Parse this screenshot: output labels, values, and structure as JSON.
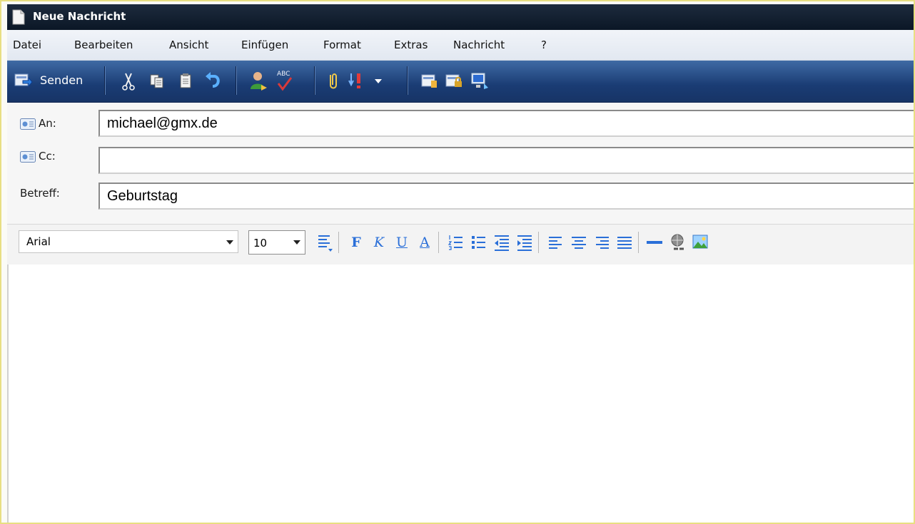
{
  "window": {
    "title": "Neue Nachricht"
  },
  "menu": [
    "Datei",
    "Bearbeiten",
    "Ansicht",
    "Einfügen",
    "Format",
    "Extras",
    "Nachricht",
    "?"
  ],
  "toolbar": {
    "send_label": "Senden",
    "spell_icon_text": "ABC",
    "icons": [
      "send-icon",
      "cut-icon",
      "copy-icon",
      "paste-icon",
      "undo-icon",
      "contacts-icon",
      "spellcheck-icon",
      "attach-icon",
      "priority-icon",
      "dropdown-icon",
      "sign-icon",
      "encrypt-icon",
      "work-offline-icon"
    ]
  },
  "headers": {
    "to": {
      "label": "An:",
      "value": "michael@gmx.de"
    },
    "cc": {
      "label": "Cc:",
      "value": ""
    },
    "subject": {
      "label": "Betreff:",
      "value": "Geburtstag"
    }
  },
  "format": {
    "font": "Arial",
    "size": "10",
    "bold": "F",
    "italic": "K",
    "underline": "U",
    "font_color": "A"
  },
  "colors": {
    "title_bar": "#0f1c2e",
    "toolbar": "#1f4480",
    "window_border": "#e8df82",
    "format_icon": "#2a6fd8"
  }
}
